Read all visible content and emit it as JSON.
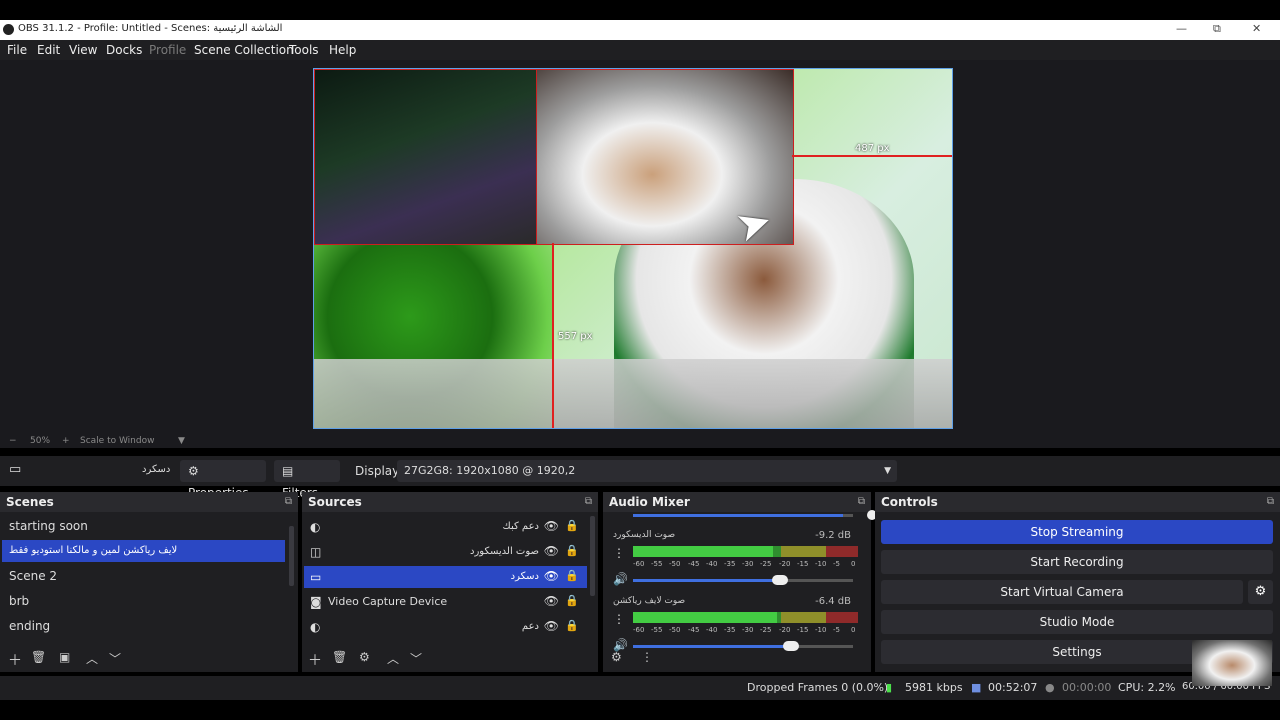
{
  "window": {
    "title": "OBS 31.1.2 - Profile: Untitled - Scenes: الشاشة الرئيسية",
    "minimize_glyph": "—",
    "restore_glyph": "⧉",
    "close_glyph": "✕"
  },
  "menu": [
    "File",
    "Edit",
    "View",
    "Docks",
    "Profile",
    "Scene Collection",
    "Tools",
    "Help"
  ],
  "preview": {
    "label_horizontal": "487 px",
    "label_vertical": "557 px",
    "zoom": "50%",
    "scale_mode": "Scale to Window",
    "zoom_out": "−",
    "zoom_in": "+"
  },
  "context_bar": {
    "source_name": "دسكرد",
    "properties": "Properties",
    "filters": "Filters",
    "display_label": "Display",
    "display_value": "27G2G8: 1920x1080 @ 1920,2"
  },
  "scenes": {
    "title": "Scenes",
    "items": [
      "starting soon",
      "لايف رياكشن لمين و مالكنا  استوديو فقط",
      "Scene 2",
      "brb",
      "ending"
    ],
    "active_index": 1
  },
  "sources": {
    "title": "Sources",
    "items": [
      {
        "name": "دعم كبك",
        "icon": "browser-icon",
        "rtl": true
      },
      {
        "name": "صوت الديسكورد",
        "icon": "audio-capture-icon",
        "rtl": true
      },
      {
        "name": "دسكرد",
        "icon": "display-capture-icon",
        "rtl": true
      },
      {
        "name": "Video Capture Device",
        "icon": "camera-icon",
        "rtl": false
      },
      {
        "name": "دعم",
        "icon": "browser-icon",
        "rtl": true
      }
    ],
    "active_index": 2
  },
  "audio_mixer": {
    "title": "Audio Mixer",
    "channels": [
      {
        "name": "صوت الديسكورد",
        "db": "-9.2 dB",
        "level": 0.62,
        "volume": 0.67
      },
      {
        "name": "صوت لايف رياكشن",
        "db": "-6.4 dB",
        "level": 0.64,
        "volume": 0.72
      }
    ],
    "tick_labels": [
      "-60",
      "-55",
      "-50",
      "-45",
      "-40",
      "-35",
      "-30",
      "-25",
      "-20",
      "-15",
      "-10",
      "-5",
      "0"
    ]
  },
  "controls": {
    "title": "Controls",
    "buttons": [
      "Stop Streaming",
      "Start Recording",
      "Start Virtual Camera",
      "Studio Mode",
      "Settings"
    ]
  },
  "status": {
    "dropped_frames": "Dropped Frames 0 (0.0%)",
    "bitrate": "5981 kbps",
    "stream_time": "00:52:07",
    "record_time": "00:00:00",
    "cpu": "CPU: 2.2%",
    "fps": "60.00 / 60.00 FPS"
  },
  "colors": {
    "accent": "#2b48c4",
    "selection_border": "#e02020",
    "canvas_border": "#5fa0e8"
  }
}
